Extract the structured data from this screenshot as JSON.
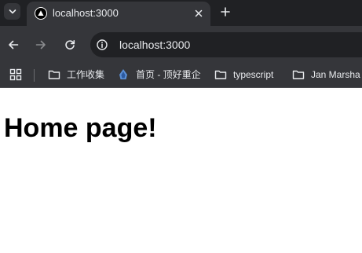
{
  "tab": {
    "title": "localhost:3000",
    "favicon": "triangle-logo-icon",
    "close_icon": "close-icon",
    "new_tab_icon": "plus-icon",
    "search_tabs_icon": "chevron-down-icon"
  },
  "toolbar": {
    "back_icon": "arrow-left-icon",
    "forward_icon": "arrow-right-icon",
    "reload_icon": "reload-icon",
    "site_info_icon": "info-icon",
    "url": "localhost:3000"
  },
  "bookmarks": {
    "apps_icon": "apps-grid-icon",
    "items": [
      {
        "label": "工作收集",
        "icon": "folder-icon"
      },
      {
        "label": "首页 - 顶好重企",
        "icon": "site-logo-icon"
      },
      {
        "label": "typescript",
        "icon": "folder-icon"
      },
      {
        "label": "Jan Marsha",
        "icon": "folder-icon"
      }
    ]
  },
  "page": {
    "heading": "Home page!"
  },
  "colors": {
    "tabstrip": "#202124",
    "toolbar": "#35363a",
    "omnibox": "#202124",
    "chrome_text": "#e8eaed",
    "page_background": "#ffffff",
    "heading_text": "#000000"
  }
}
